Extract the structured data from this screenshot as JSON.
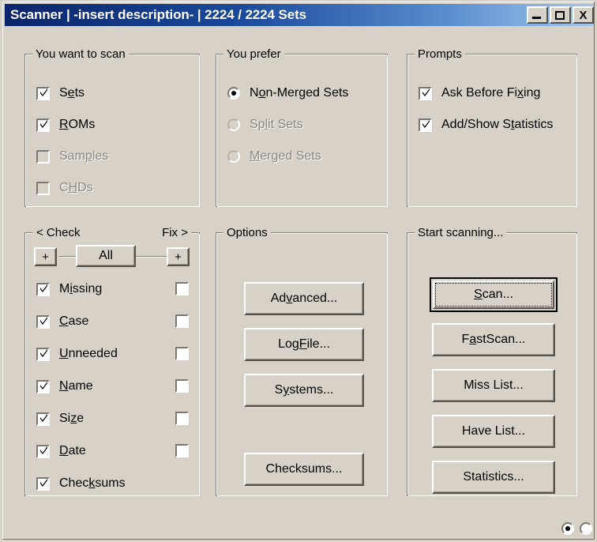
{
  "window": {
    "title": "Scanner | -insert description- | 2224 / 2224 Sets",
    "minimize_label": "_",
    "maximize_label": "",
    "close_label": "X",
    "colors": {
      "titlebar_start": "#0a246a",
      "titlebar_end": "#a6c8ea",
      "dialog_face": "#d6d2c9",
      "text": "#000000",
      "disabled_text": "#8b8780"
    }
  },
  "scan_targets": {
    "title": "You want to scan",
    "items": [
      {
        "label_pre": "S",
        "label_key": "e",
        "label_post": "ts",
        "checked": true,
        "enabled": true
      },
      {
        "label_pre": "",
        "label_key": "R",
        "label_post": "OMs",
        "checked": true,
        "enabled": true
      },
      {
        "label_pre": "Sam",
        "label_key": "p",
        "label_post": "les",
        "checked": false,
        "enabled": false
      },
      {
        "label_pre": "C",
        "label_key": "H",
        "label_post": "Ds",
        "checked": false,
        "enabled": false
      }
    ]
  },
  "preference": {
    "title": "You prefer",
    "items": [
      {
        "label_pre": "N",
        "label_key": "o",
        "label_post": "n-Merged Sets",
        "selected": true,
        "enabled": true
      },
      {
        "label_pre": "Sp",
        "label_key": "l",
        "label_post": "it Sets",
        "selected": false,
        "enabled": false
      },
      {
        "label_pre": "",
        "label_key": "M",
        "label_post": "erged Sets",
        "selected": false,
        "enabled": false
      }
    ]
  },
  "prompts": {
    "title": "Prompts",
    "items": [
      {
        "label_pre": "Ask Before Fi",
        "label_key": "x",
        "label_post": "ing",
        "checked": true,
        "enabled": true
      },
      {
        "label_pre": "Add/Show S",
        "label_key": "t",
        "label_post": "atistics",
        "checked": true,
        "enabled": true
      }
    ]
  },
  "check_fix": {
    "title_left": "< Check",
    "title_right": "Fix >",
    "all_button": "All",
    "plus_left": "+",
    "plus_right": "+",
    "rows": [
      {
        "label_pre": "M",
        "label_key": "i",
        "label_post": "ssing",
        "check": true,
        "fix": false,
        "has_fix": true
      },
      {
        "label_pre": "",
        "label_key": "C",
        "label_post": "ase",
        "check": true,
        "fix": false,
        "has_fix": true
      },
      {
        "label_pre": "",
        "label_key": "U",
        "label_post": "nneeded",
        "check": true,
        "fix": false,
        "has_fix": true
      },
      {
        "label_pre": "",
        "label_key": "N",
        "label_post": "ame",
        "check": true,
        "fix": false,
        "has_fix": true
      },
      {
        "label_pre": "Si",
        "label_key": "z",
        "label_post": "e",
        "check": true,
        "fix": false,
        "has_fix": true
      },
      {
        "label_pre": "",
        "label_key": "D",
        "label_post": "ate",
        "check": true,
        "fix": false,
        "has_fix": true
      },
      {
        "label_pre": "Chec",
        "label_key": "k",
        "label_post": "sums",
        "check": true,
        "fix": false,
        "has_fix": false
      }
    ]
  },
  "options": {
    "title": "Options",
    "buttons": [
      {
        "label_pre": "Ad",
        "label_key": "v",
        "label_post": "anced..."
      },
      {
        "label_pre": "Log",
        "label_key": "F",
        "label_post": "ile..."
      },
      {
        "label_pre": "S",
        "label_key": "y",
        "label_post": "stems..."
      },
      {
        "label_pre": "Checksums...",
        "label_key": "",
        "label_post": ""
      }
    ]
  },
  "start_scanning": {
    "title": "Start scanning...",
    "buttons": [
      {
        "label_pre": "",
        "label_key": "S",
        "label_post": "can...",
        "default": true
      },
      {
        "label_pre": "F",
        "label_key": "a",
        "label_post": "stScan...",
        "default": false
      },
      {
        "label_pre": "Miss List...",
        "label_key": "",
        "label_post": "",
        "default": false
      },
      {
        "label_pre": "Have List...",
        "label_key": "",
        "label_post": "",
        "default": false
      },
      {
        "label_pre": "Statistics...",
        "label_key": "",
        "label_post": "",
        "default": false
      }
    ]
  },
  "status_indicators": [
    {
      "name": "indicator-left",
      "selected": true
    },
    {
      "name": "indicator-right",
      "selected": false
    }
  ]
}
